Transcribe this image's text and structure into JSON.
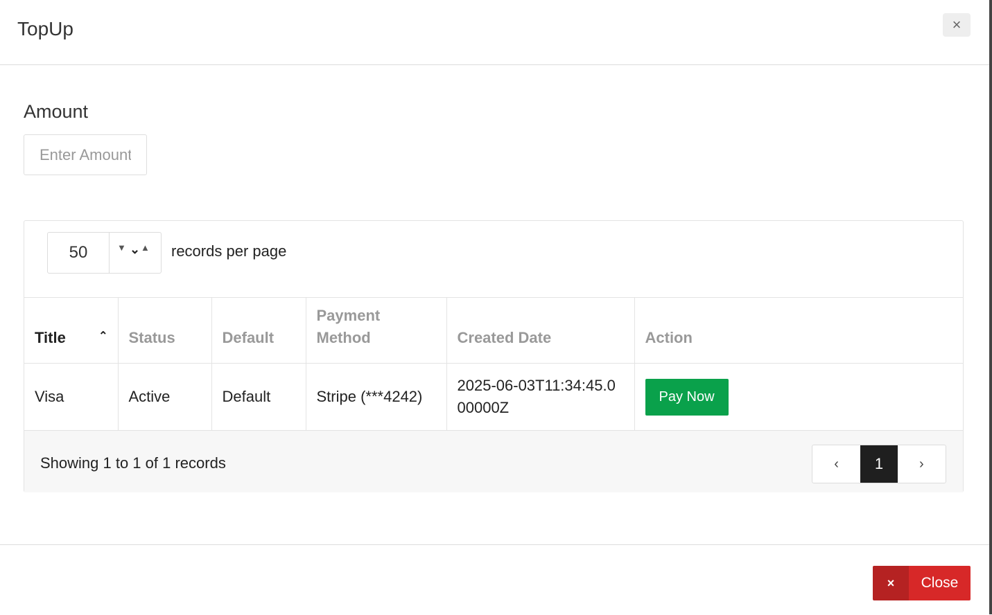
{
  "modal": {
    "title": "TopUp",
    "close_icon": "×"
  },
  "amount": {
    "label": "Amount",
    "placeholder": "Enter Amount",
    "value": ""
  },
  "table_controls": {
    "per_page_value": "50",
    "per_page_label": "records per page"
  },
  "table": {
    "columns": [
      "Title",
      "Status",
      "Default",
      "Payment Method",
      "Created Date",
      "Action"
    ],
    "sorted_column": "Title",
    "sort_direction": "ascending",
    "rows": [
      {
        "title": "Visa",
        "status": "Active",
        "default": "Default",
        "payment_method": "Stripe (***4242)",
        "created_date": "2025-06-03T11:34:45.000000Z",
        "action_label": "Pay Now"
      }
    ]
  },
  "footer_info": {
    "showing_text": "Showing 1 to 1 of 1 records",
    "current_page": "1",
    "prev_icon": "‹",
    "next_icon": "›"
  },
  "modal_footer": {
    "close_label": "Close",
    "close_icon": "×"
  },
  "colors": {
    "pay_button": "#0aa14b",
    "close_button": "#d72828",
    "active_page": "#1f1f1f"
  }
}
